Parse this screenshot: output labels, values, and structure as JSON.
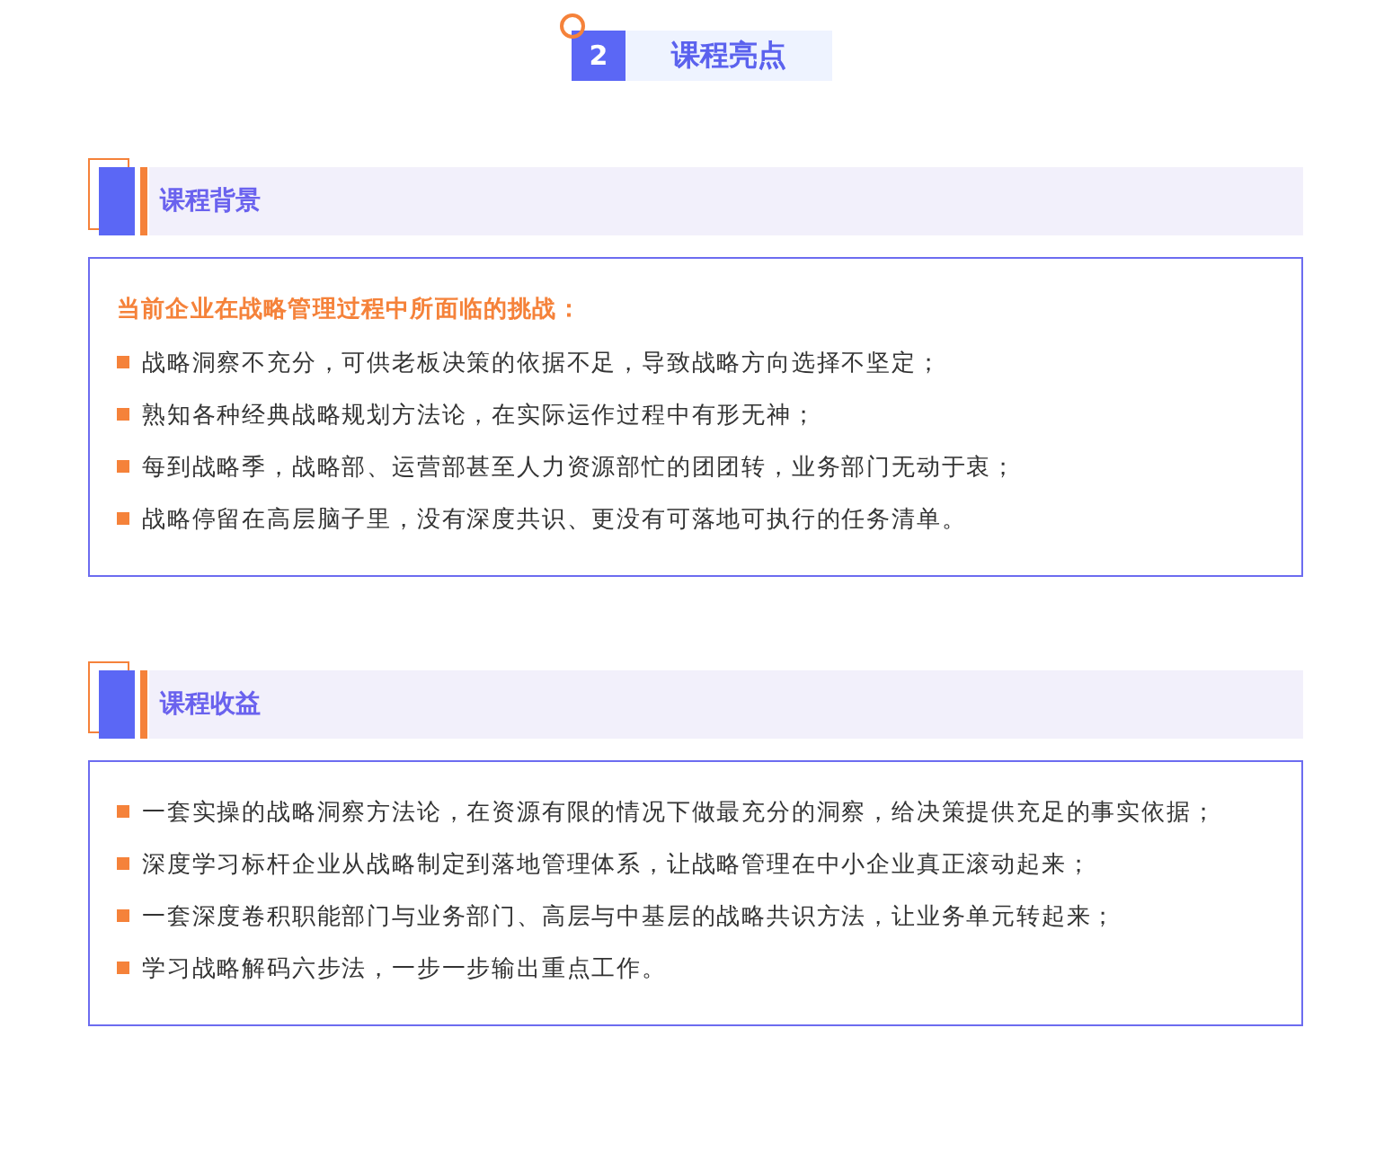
{
  "top_heading": {
    "number": "2",
    "title": "课程亮点"
  },
  "sections": [
    {
      "title": "课程背景",
      "lead": "当前企业在战略管理过程中所面临的挑战：",
      "items": [
        "战略洞察不充分，可供老板决策的依据不足，导致战略方向选择不坚定；",
        "熟知各种经典战略规划方法论，在实际运作过程中有形无神；",
        "每到战略季，战略部、运营部甚至人力资源部忙的团团转，业务部门无动于衷；",
        "战略停留在高层脑子里，没有深度共识、更没有可落地可执行的任务清单。"
      ]
    },
    {
      "title": "课程收益",
      "items": [
        "一套实操的战略洞察方法论，在资源有限的情况下做最充分的洞察，给决策提供充足的事实依据；",
        "深度学习标杆企业从战略制定到落地管理体系，让战略管理在中小企业真正滚动起来；",
        "一套深度卷积职能部门与业务部门、高层与中基层的战略共识方法，让业务单元转起来；",
        "学习战略解码六步法，一步一步输出重点工作。"
      ]
    }
  ]
}
